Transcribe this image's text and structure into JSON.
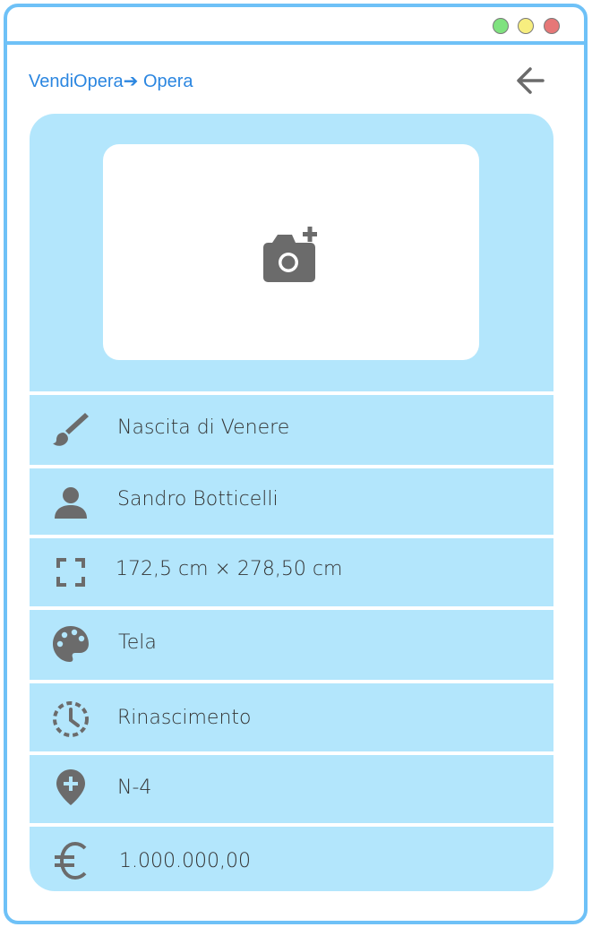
{
  "window": {
    "controls": [
      "green",
      "yellow",
      "red"
    ]
  },
  "header": {
    "breadcrumb": "VendiOpera➔ Opera",
    "back_icon": "arrow-left-icon"
  },
  "photo": {
    "icon": "camera-plus-icon"
  },
  "fields": {
    "title": {
      "icon": "brush-icon",
      "value": "Nascita di Venere"
    },
    "author": {
      "icon": "person-icon",
      "value": "Sandro Botticelli"
    },
    "dimensions": {
      "icon": "fullscreen-icon",
      "value": "172,5 cm × 278,50 cm"
    },
    "technique": {
      "icon": "palette-icon",
      "value": "Tela"
    },
    "period": {
      "icon": "history-icon",
      "value": "Rinascimento"
    },
    "location": {
      "icon": "add-location-icon",
      "value": "N-4"
    },
    "price": {
      "icon": "euro-icon",
      "value": "1.000.000,00"
    }
  },
  "colors": {
    "accent": "#2b86e0",
    "border": "#6ec1f7",
    "card": "#b3e6fc",
    "icon": "#6b6b6b"
  }
}
